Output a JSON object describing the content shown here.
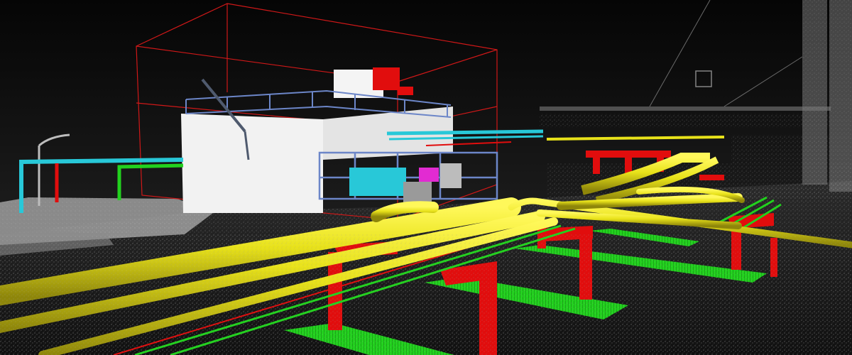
{
  "scene": {
    "colors": {
      "sky_top": "#050505",
      "sky_bottom": "#2a2a2a",
      "ground": "#161616",
      "point_cloud": "#bdbdbd",
      "pipe_yellow": "#e8e21a",
      "pipe_yellow_shade": "#a9a10c",
      "support_red": "#e10d0d",
      "support_green": "#22d11e",
      "pipe_cyan": "#28c8d8",
      "wireframe_red": "#d01818",
      "building_white": "#f2f2f2",
      "steel_blue": "#6c86c8",
      "magenta": "#e22bd2"
    },
    "icons": [
      "point-cloud",
      "bim-model"
    ]
  }
}
